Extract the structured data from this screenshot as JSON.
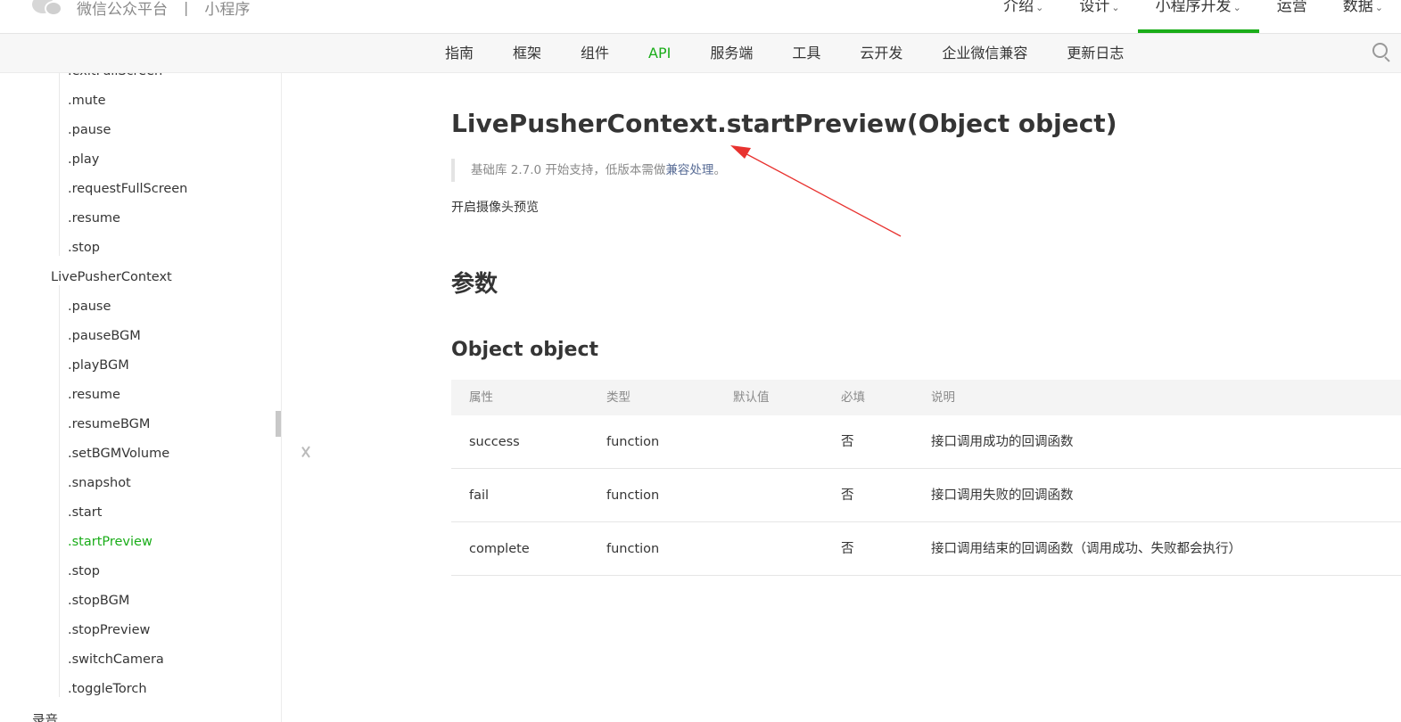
{
  "header": {
    "brand": "微信公众平台",
    "separator": "|",
    "product": "小程序",
    "nav": [
      {
        "label": "介绍",
        "chevron": "⌄",
        "active": false
      },
      {
        "label": "设计",
        "chevron": "⌄",
        "active": false
      },
      {
        "label": "小程序开发",
        "chevron": "⌄",
        "active": true
      },
      {
        "label": "运营",
        "chevron": "",
        "active": false
      },
      {
        "label": "数据",
        "chevron": "⌄",
        "active": false
      }
    ]
  },
  "subnav": {
    "items": [
      "指南",
      "框架",
      "组件",
      "API",
      "服务端",
      "工具",
      "云开发",
      "企业微信兼容",
      "更新日志"
    ],
    "active": "API",
    "search_icon": "search-icon"
  },
  "sidebar": {
    "items": [
      {
        "label": ".exitFullScreen",
        "level": 2
      },
      {
        "label": ".mute",
        "level": 2
      },
      {
        "label": ".pause",
        "level": 2
      },
      {
        "label": ".play",
        "level": 2
      },
      {
        "label": ".requestFullScreen",
        "level": 2
      },
      {
        "label": ".resume",
        "level": 2
      },
      {
        "label": ".stop",
        "level": 2
      },
      {
        "label": "LivePusherContext",
        "level": 1
      },
      {
        "label": ".pause",
        "level": 2
      },
      {
        "label": ".pauseBGM",
        "level": 2
      },
      {
        "label": ".playBGM",
        "level": 2
      },
      {
        "label": ".resume",
        "level": 2
      },
      {
        "label": ".resumeBGM",
        "level": 2
      },
      {
        "label": ".setBGMVolume",
        "level": 2
      },
      {
        "label": ".snapshot",
        "level": 2
      },
      {
        "label": ".start",
        "level": 2
      },
      {
        "label": ".startPreview",
        "level": 2,
        "active": true
      },
      {
        "label": ".stop",
        "level": 2
      },
      {
        "label": ".stopBGM",
        "level": 2
      },
      {
        "label": ".stopPreview",
        "level": 2
      },
      {
        "label": ".switchCamera",
        "level": 2
      },
      {
        "label": ".toggleTorch",
        "level": 2
      },
      {
        "label": "录音",
        "level": 0
      }
    ]
  },
  "main": {
    "title": "LivePusherContext.startPreview(Object object)",
    "note_prefix": "基础库 2.7.0 开始支持，低版本需做",
    "note_link": "兼容处理",
    "note_suffix": "。",
    "description": "开启摄像头预览",
    "params_heading": "参数",
    "object_heading": "Object object",
    "table": {
      "headers": [
        "属性",
        "类型",
        "默认值",
        "必填",
        "说明"
      ],
      "rows": [
        [
          "success",
          "function",
          "",
          "否",
          "接口调用成功的回调函数"
        ],
        [
          "fail",
          "function",
          "",
          "否",
          "接口调用失败的回调函数"
        ],
        [
          "complete",
          "function",
          "",
          "否",
          "接口调用结束的回调函数（调用成功、失败都会执行）"
        ]
      ]
    }
  },
  "colors": {
    "accent": "#1aad19",
    "link": "#576b95",
    "annotation_arrow": "#e8322f"
  }
}
